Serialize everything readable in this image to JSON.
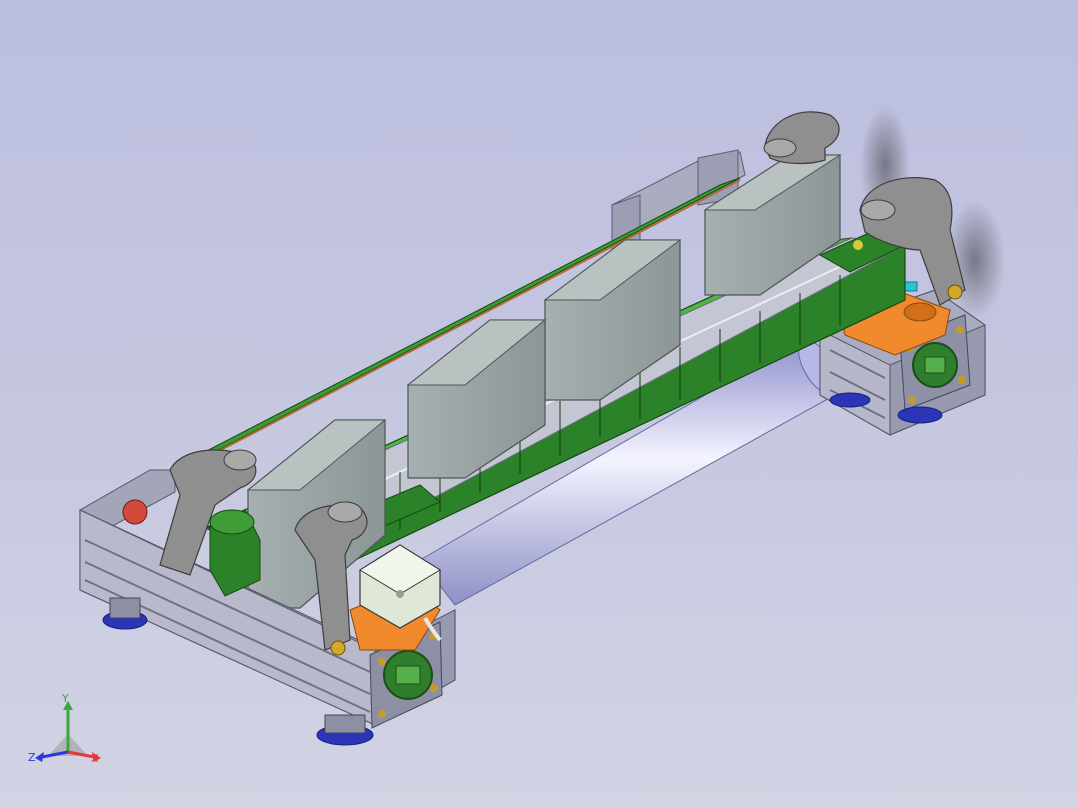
{
  "viewport": {
    "background_top": "#bcbedf",
    "background_bottom": "#d2d3e3"
  },
  "model": {
    "colors": {
      "frame_aluminum": "#a7a9bc",
      "frame_dark": "#6f7188",
      "belt_green": "#2f8a2a",
      "belt_green_light": "#49b23e",
      "block_gray": "#8f9a9a",
      "block_gray_light": "#a9b3b3",
      "clamp_gray": "#8e8e8e",
      "cylinder_blue": "#c9c8ee",
      "bracket_orange": "#f08a2c",
      "foot_blue": "#2b35b8",
      "sensor_cyan": "#29c4d6"
    },
    "parts": [
      "aluminum-profile-frame",
      "conveyor-belt",
      "carried-blocks",
      "corner-clamps",
      "guide-cylinder",
      "motor-mounts",
      "leveling-feet"
    ]
  },
  "triad": {
    "x_label": "X",
    "y_label": "Y",
    "z_label": "Z",
    "x_color": "#e23a3a",
    "y_color": "#3aa83a",
    "z_color": "#2a3bd6"
  }
}
